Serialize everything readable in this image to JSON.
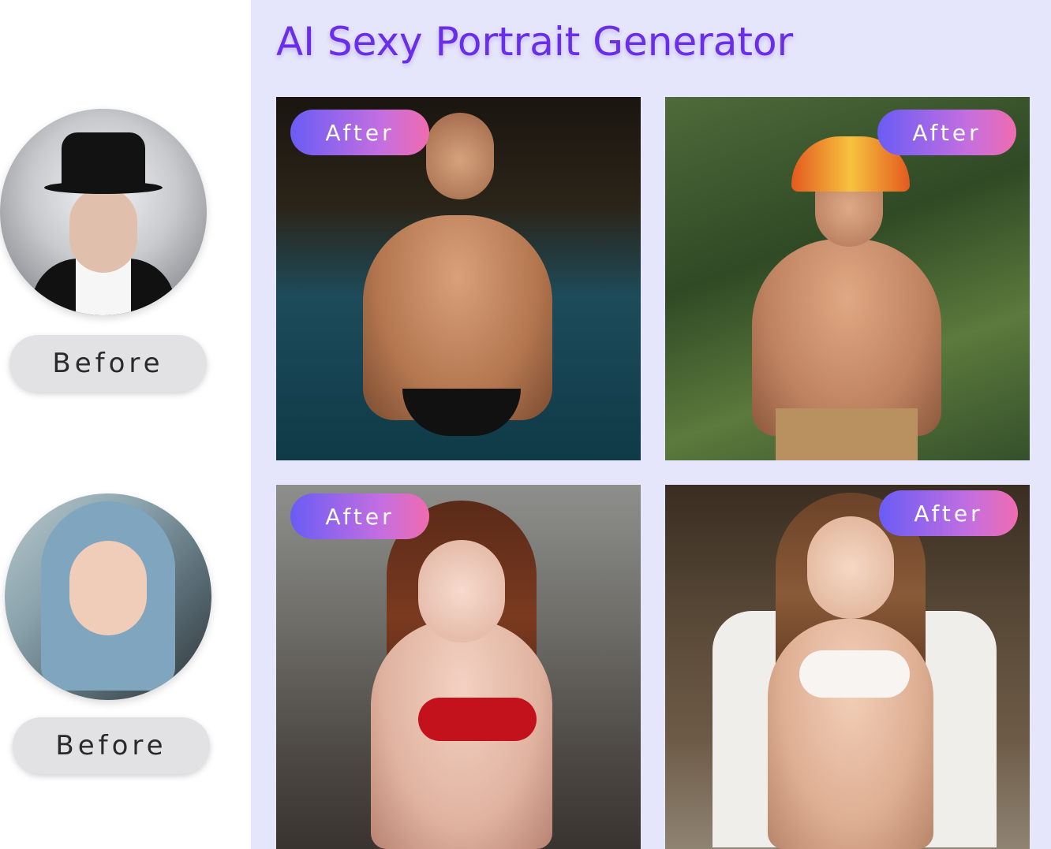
{
  "title": "AI Sexy Portrait Generator",
  "before_label": "Before",
  "after_label": "After",
  "colors": {
    "title": "#6a2ee8",
    "panel_background": "#e5e6fb",
    "after_gradient_start": "#6a5cf5",
    "after_gradient_end": "#f06cb0",
    "before_pill": "#e2e2e4"
  }
}
